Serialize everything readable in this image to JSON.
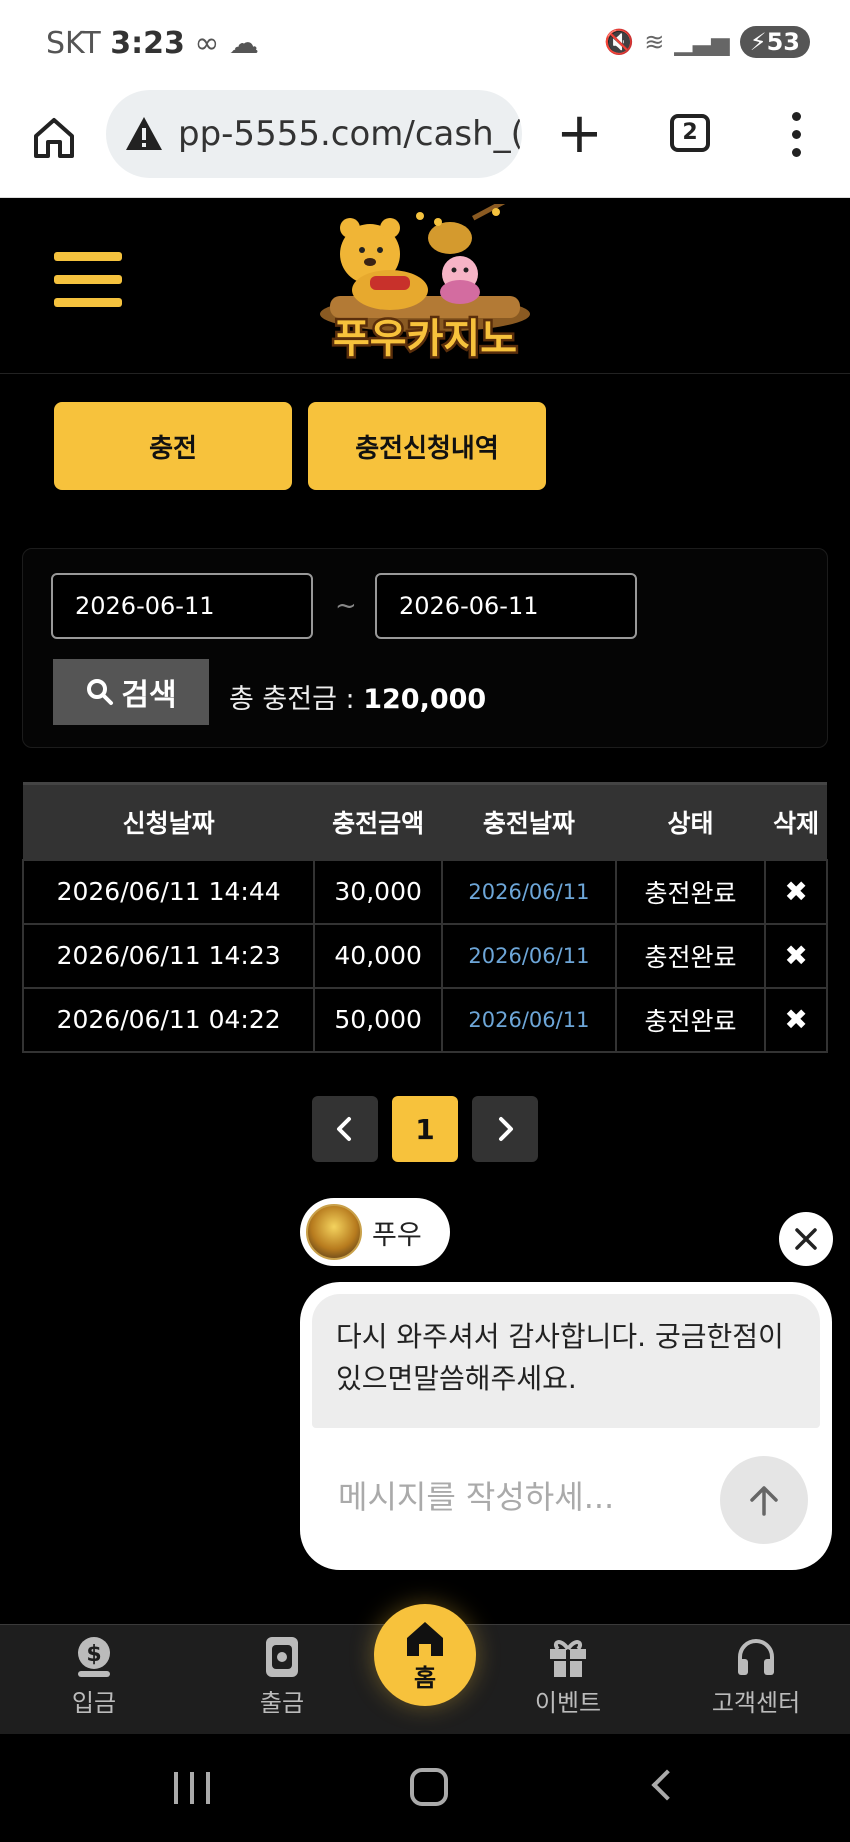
{
  "status_bar": {
    "carrier": "SKT",
    "time": "3:23",
    "battery": "53"
  },
  "browser": {
    "url": "pp-5555.com/cash_(",
    "tab_count": "2"
  },
  "site": {
    "logo_text": "푸우카지노"
  },
  "tabs": [
    {
      "label": "충전"
    },
    {
      "label": "충전신청내역"
    }
  ],
  "search": {
    "date_from": "2026-06-11",
    "separator": "~",
    "date_to": "2026-06-11",
    "button_label": "검색",
    "total_label": "총 충전금 :",
    "total_value": "120,000"
  },
  "table": {
    "headers": [
      "신청날짜",
      "충전금액",
      "충전날짜",
      "상태",
      "삭제"
    ],
    "rows": [
      {
        "requested": "2026/06/11 14:44",
        "amount": "30,000",
        "charged": "2026/06/11",
        "status": "충전완료",
        "delete": "✖"
      },
      {
        "requested": "2026/06/11 14:23",
        "amount": "40,000",
        "charged": "2026/06/11",
        "status": "충전완료",
        "delete": "✖"
      },
      {
        "requested": "2026/06/11 04:22",
        "amount": "50,000",
        "charged": "2026/06/11",
        "status": "충전완료",
        "delete": "✖"
      }
    ]
  },
  "pagination": {
    "current": "1"
  },
  "chat": {
    "agent_name": "푸우",
    "message": "다시 와주셔서 감사합니다. 궁금한점이 있으면말씀해주세요.",
    "input_placeholder": "메시지를 작성하세..."
  },
  "bottom_nav": [
    {
      "label": "입금",
      "icon": "dollar-coin-icon"
    },
    {
      "label": "출금",
      "icon": "wallet-icon"
    },
    {
      "label": "홈",
      "icon": "home-icon"
    },
    {
      "label": "이벤트",
      "icon": "gift-icon"
    },
    {
      "label": "고객센터",
      "icon": "headset-icon"
    }
  ],
  "colors": {
    "accent": "#f7c23c",
    "background": "#000000",
    "link": "#6da6d8"
  }
}
